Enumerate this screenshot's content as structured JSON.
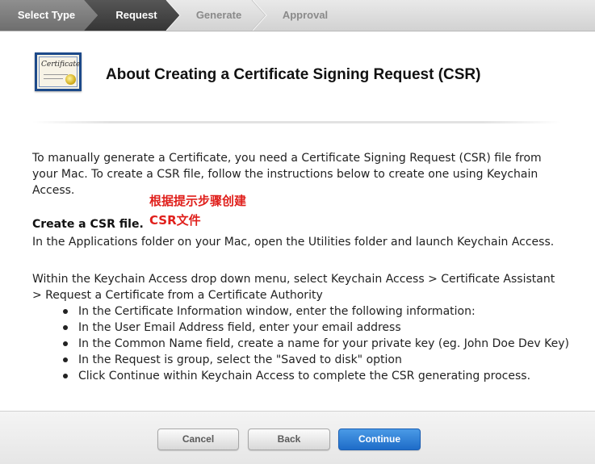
{
  "steps": [
    {
      "label": "Select Type",
      "state": "done"
    },
    {
      "label": "Request",
      "state": "current"
    },
    {
      "label": "Generate",
      "state": "todo"
    },
    {
      "label": "Approval",
      "state": "todo"
    }
  ],
  "header": {
    "icon": "certificate-icon",
    "icon_text": "Certificate",
    "title": "About Creating a Certificate Signing Request (CSR)"
  },
  "intro": "To manually generate a Certificate, you need a Certificate Signing Request (CSR) file from your Mac. To create a CSR file, follow the instructions below to create one using Keychain Access.",
  "annotation": {
    "line1": "根据提示步骤创建",
    "line2": "CSR文件",
    "color": "#e0201c"
  },
  "section": {
    "heading": "Create a CSR file.",
    "body": "In the Applications folder on your Mac, open the Utilities folder and launch Keychain Access.",
    "instructions": "Within the Keychain Access drop down menu, select Keychain Access > Certificate Assistant > Request a Certificate from a Certificate Authority",
    "bullets": [
      "In the Certificate Information window, enter the following information:",
      "In the User Email Address field, enter your email address",
      "In the Common Name field, create a name for your private key (eg. John Doe Dev Key)",
      "In the Request is group, select the \"Saved to disk\" option",
      "Click Continue within Keychain Access to complete the CSR generating process."
    ]
  },
  "footer": {
    "cancel_label": "Cancel",
    "back_label": "Back",
    "continue_label": "Continue"
  },
  "colors": {
    "step_done": "#7d7d7d",
    "step_current": "#3f3f3f",
    "primary_button": "#2a78d4"
  }
}
